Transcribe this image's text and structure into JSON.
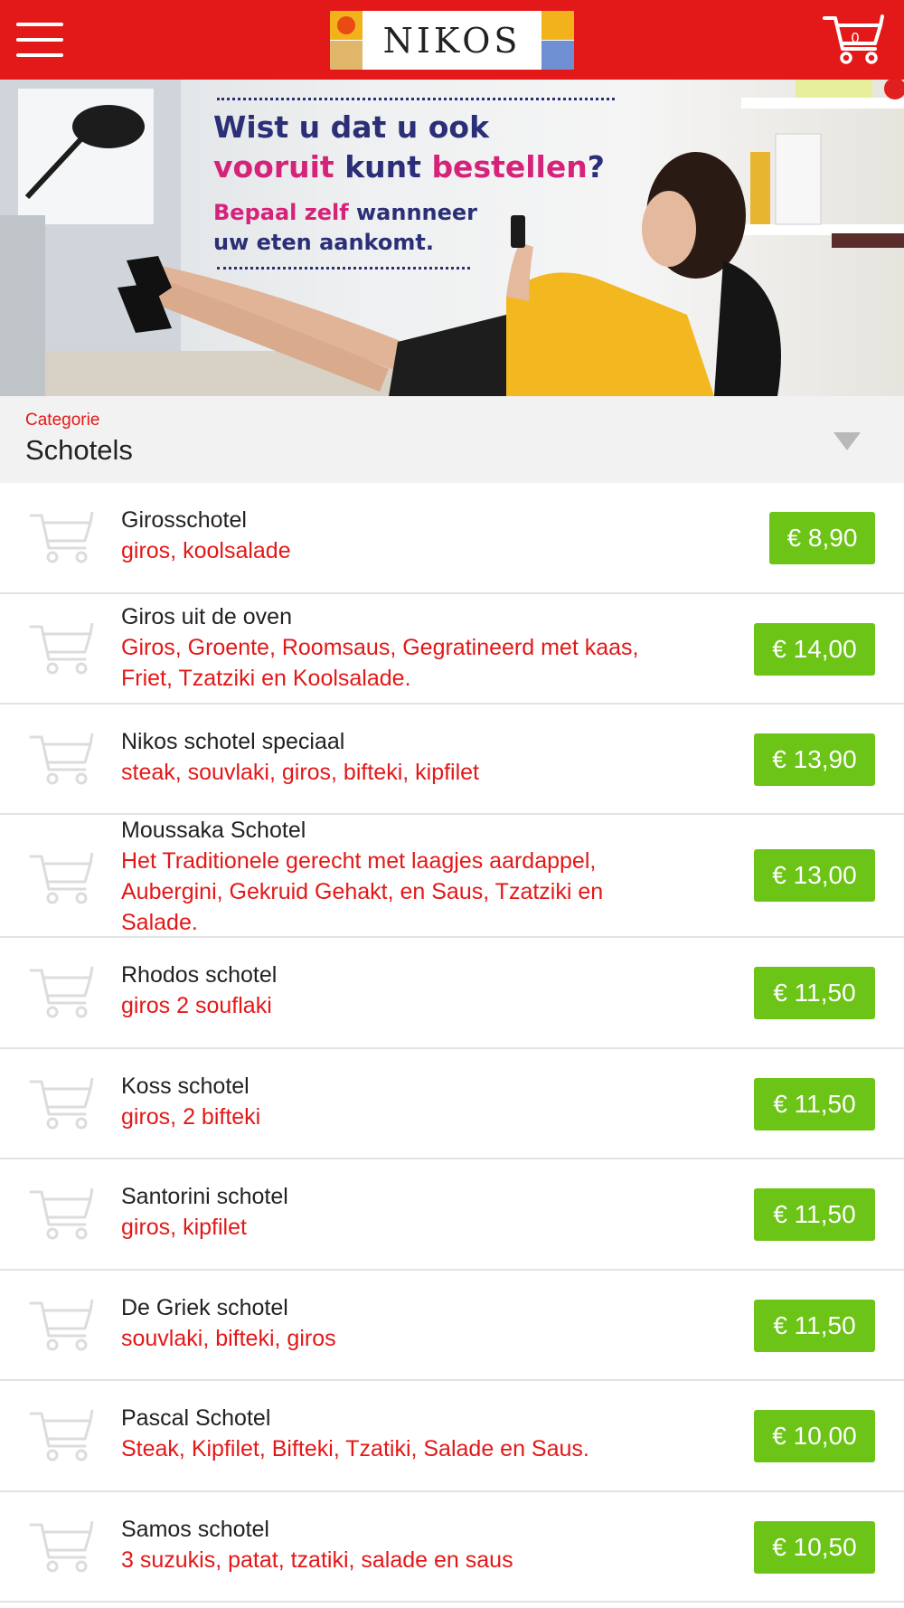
{
  "header": {
    "logo_text": "NIKOS",
    "cart_count": "0"
  },
  "banner": {
    "line1": "Wist u dat u ook",
    "line2_pink_a": "vooruit",
    "line2_blue": "kunt",
    "line2_pink_b": "bestellen",
    "line2_end": "?",
    "sub1_pink": "Bepaal zelf",
    "sub1_blue": "wannneer",
    "sub2": "uw eten aankomt."
  },
  "category": {
    "label": "Categorie",
    "value": "Schotels"
  },
  "products": [
    {
      "name": "Girosschotel",
      "desc": "giros, koolsalade",
      "price": "€ 8,90"
    },
    {
      "name": "Giros uit de oven",
      "desc": "Giros, Groente, Roomsaus, Gegratineerd met kaas, Friet, Tzatziki en Koolsalade.",
      "price": "€ 14,00"
    },
    {
      "name": "Nikos schotel speciaal",
      "desc": "steak, souvlaki, giros, bifteki, kipfilet",
      "price": "€ 13,90"
    },
    {
      "name": "Moussaka Schotel",
      "desc": "Het Traditionele gerecht met laagjes aardappel, Aubergini, Gekruid Gehakt, en Saus, Tzatziki en Salade.",
      "price": "€ 13,00"
    },
    {
      "name": "Rhodos schotel",
      "desc": "giros 2 souflaki",
      "price": "€ 11,50"
    },
    {
      "name": "Koss schotel",
      "desc": "giros, 2 bifteki",
      "price": "€ 11,50"
    },
    {
      "name": "Santorini schotel",
      "desc": "giros, kipfilet",
      "price": "€ 11,50"
    },
    {
      "name": "De Griek schotel",
      "desc": "souvlaki, bifteki, giros",
      "price": "€ 11,50"
    },
    {
      "name": "Pascal Schotel",
      "desc": "Steak, Kipfilet, Bifteki, Tzatiki, Salade en Saus.",
      "price": "€ 10,00"
    },
    {
      "name": "Samos schotel",
      "desc": "3 suzukis, patat, tzatiki, salade en saus",
      "price": "€ 10,50"
    }
  ],
  "colors": {
    "brand_red": "#e31818",
    "price_green": "#6cc417",
    "banner_blue": "#2a2f78",
    "banner_pink": "#d6237a"
  }
}
